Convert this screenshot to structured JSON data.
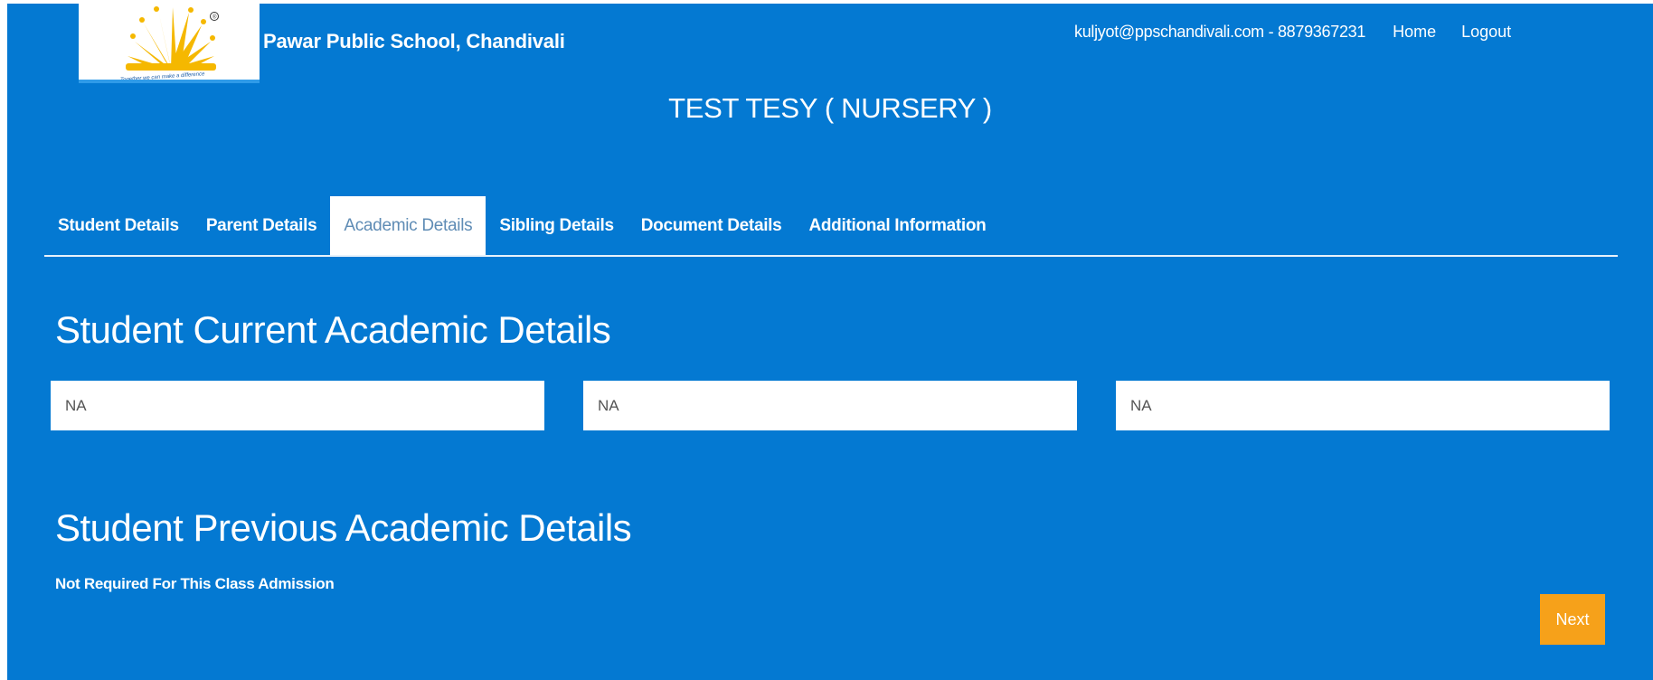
{
  "header": {
    "logo": {
      "tagline": "Together we can make a difference",
      "registered_mark": "®",
      "sun_color": "#f5b800"
    },
    "school_name": "Pawar Public School, Chandivali",
    "user_info": "kuljyot@ppschandivali.com - 8879367231",
    "nav": {
      "home": "Home",
      "logout": "Logout"
    }
  },
  "student_title": "TEST TESY ( NURSERY )",
  "tabs": [
    {
      "label": "Student Details",
      "active": false
    },
    {
      "label": "Parent Details",
      "active": false
    },
    {
      "label": "Academic Details",
      "active": true
    },
    {
      "label": "Sibling Details",
      "active": false
    },
    {
      "label": "Document Details",
      "active": false
    },
    {
      "label": "Additional Information",
      "active": false
    }
  ],
  "current_academic": {
    "heading": "Student Current Academic Details",
    "fields": [
      {
        "value": "NA"
      },
      {
        "value": "NA"
      },
      {
        "value": "NA"
      }
    ]
  },
  "previous_academic": {
    "heading": "Student Previous Academic Details",
    "note": "Not Required For This Class Admission"
  },
  "actions": {
    "next_label": "Next"
  },
  "colors": {
    "background": "#0479d2",
    "active_tab_text": "#5f8cb5",
    "next_button": "#f6a11a"
  }
}
